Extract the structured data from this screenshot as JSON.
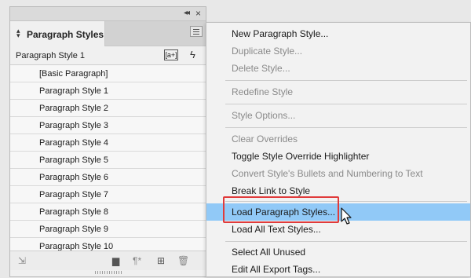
{
  "panel": {
    "tab_label": "Paragraph Styles",
    "current_style": "Paragraph Style 1",
    "new_style_icon": "[a+]",
    "styles": [
      "[Basic Paragraph]",
      "Paragraph Style 1",
      "Paragraph Style 2",
      "Paragraph Style 3",
      "Paragraph Style 4",
      "Paragraph Style 5",
      "Paragraph Style 6",
      "Paragraph Style 7",
      "Paragraph Style 8",
      "Paragraph Style 9",
      "Paragraph Style 10"
    ]
  },
  "menu": {
    "items": [
      {
        "label": "New Paragraph Style...",
        "enabled": true
      },
      {
        "label": "Duplicate Style...",
        "enabled": false
      },
      {
        "label": "Delete Style...",
        "enabled": false
      },
      {
        "label": "Redefine Style",
        "enabled": false
      },
      {
        "label": "Style Options...",
        "enabled": false
      },
      {
        "label": "Clear Overrides",
        "enabled": false
      },
      {
        "label": "Toggle Style Override Highlighter",
        "enabled": true
      },
      {
        "label": "Convert Style's Bullets and Numbering to Text",
        "enabled": false
      },
      {
        "label": "Break Link to Style",
        "enabled": true
      },
      {
        "label": "Load Paragraph Styles...",
        "enabled": true,
        "highlighted": true
      },
      {
        "label": "Load All Text Styles...",
        "enabled": true
      },
      {
        "label": "Select All Unused",
        "enabled": true
      },
      {
        "label": "Edit All Export Tags...",
        "enabled": true
      }
    ]
  },
  "colors": {
    "highlight": "#91c9f7",
    "callout": "#e03b3b"
  }
}
